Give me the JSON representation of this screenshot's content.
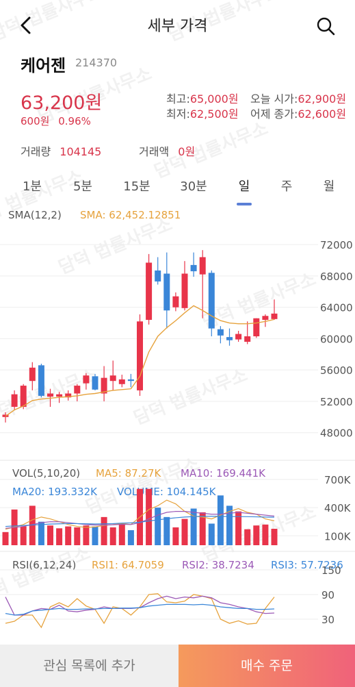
{
  "header": {
    "title": "세부 가격"
  },
  "stock": {
    "name": "케어젠",
    "code": "214370",
    "price": "63,200원",
    "change": "600원",
    "change_rate": "0.96%"
  },
  "stats": {
    "high_label": "최고:",
    "high": "65,000원",
    "open_label": "오늘 시가:",
    "open": "62,900원",
    "low_label": "최저:",
    "low": "62,500원",
    "prev_label": "어제 종가:",
    "prev": "62,600원",
    "volume_label": "거래량",
    "volume": "104145",
    "amount_label": "거래액",
    "amount": "0원"
  },
  "tabs": [
    "1분",
    "5분",
    "15분",
    "30분",
    "일",
    "주",
    "월"
  ],
  "active_tab": "일",
  "indicators": {
    "sma_label": "SMA(12,2)",
    "sma_value": "SMA: 62,452.12851",
    "vol_label": "VOL(5,10,20)",
    "ma5": "MA5: 87.27K",
    "ma10": "MA10: 169.441K",
    "ma20": "MA20: 193.332K",
    "volume": "VOLUME: 104.145K",
    "rsi_label": "RSI(6,12,24)",
    "rsi1": "RSI1: 64.7059",
    "rsi2": "RSI2: 38.7234",
    "rsi3": "RSI3: 57.7236"
  },
  "colors": {
    "up": "#e8344a",
    "down": "#3a86d8",
    "sma": "#e6a23c",
    "ma10": "#9b59b6",
    "ma20": "#3a86d8",
    "accent": "#d8344a"
  },
  "watermark": "담덕 법률사무소",
  "footer": {
    "watchlist": "관심 목록에 추가",
    "buy": "매수 주문"
  },
  "chart_data": {
    "type": "candlestick",
    "price_axis": {
      "ylim": [
        46400,
        72800
      ],
      "ticks": [
        "72000",
        "68000",
        "64000",
        "60000",
        "56000",
        "52000",
        "48000"
      ]
    },
    "volume_axis": {
      "ticks": [
        "700K",
        "400K",
        "100K"
      ]
    },
    "rsi_axis": {
      "ticks": [
        "150",
        "90",
        "30"
      ]
    },
    "candles": [
      {
        "o": 50000,
        "h": 50600,
        "l": 49300,
        "c": 50300
      },
      {
        "o": 51300,
        "h": 53400,
        "l": 50900,
        "c": 52900
      },
      {
        "o": 51300,
        "h": 54200,
        "l": 51000,
        "c": 54000
      },
      {
        "o": 54600,
        "h": 57000,
        "l": 53400,
        "c": 56300
      },
      {
        "o": 56600,
        "h": 56800,
        "l": 52500,
        "c": 52700
      },
      {
        "o": 52600,
        "h": 53600,
        "l": 51300,
        "c": 53000
      },
      {
        "o": 52600,
        "h": 53200,
        "l": 51800,
        "c": 52900
      },
      {
        "o": 52500,
        "h": 53400,
        "l": 52100,
        "c": 53000
      },
      {
        "o": 53000,
        "h": 54200,
        "l": 52000,
        "c": 54000
      },
      {
        "o": 54300,
        "h": 55600,
        "l": 53500,
        "c": 55300
      },
      {
        "o": 55200,
        "h": 55500,
        "l": 53400,
        "c": 53500
      },
      {
        "o": 53000,
        "h": 56500,
        "l": 52000,
        "c": 55000
      },
      {
        "o": 54600,
        "h": 57200,
        "l": 53400,
        "c": 55300
      },
      {
        "o": 54200,
        "h": 55400,
        "l": 53800,
        "c": 54800
      },
      {
        "o": 54800,
        "h": 55500,
        "l": 53800,
        "c": 54600
      },
      {
        "o": 53400,
        "h": 63100,
        "l": 52700,
        "c": 62200
      },
      {
        "o": 62400,
        "h": 70800,
        "l": 61800,
        "c": 69700
      },
      {
        "o": 68700,
        "h": 70400,
        "l": 66900,
        "c": 67300
      },
      {
        "o": 68300,
        "h": 71000,
        "l": 61300,
        "c": 63600
      },
      {
        "o": 64000,
        "h": 65900,
        "l": 63500,
        "c": 65400
      },
      {
        "o": 63900,
        "h": 69900,
        "l": 63600,
        "c": 68300
      },
      {
        "o": 69400,
        "h": 71000,
        "l": 67900,
        "c": 68600
      },
      {
        "o": 68200,
        "h": 71300,
        "l": 62600,
        "c": 70400
      },
      {
        "o": 68400,
        "h": 68700,
        "l": 60300,
        "c": 61300
      },
      {
        "o": 61200,
        "h": 61600,
        "l": 59400,
        "c": 60400
      },
      {
        "o": 60200,
        "h": 61300,
        "l": 59100,
        "c": 59800
      },
      {
        "o": 59900,
        "h": 61000,
        "l": 59600,
        "c": 60600
      },
      {
        "o": 59600,
        "h": 62200,
        "l": 59300,
        "c": 60300
      },
      {
        "o": 60300,
        "h": 62600,
        "l": 60100,
        "c": 62600
      },
      {
        "o": 62400,
        "h": 63100,
        "l": 61500,
        "c": 62900
      },
      {
        "o": 62500,
        "h": 65000,
        "l": 62400,
        "c": 63200
      }
    ],
    "sma": [
      50100,
      50900,
      51400,
      52100,
      52300,
      52400,
      52500,
      52600,
      52700,
      52900,
      53000,
      53200,
      53400,
      53500,
      53600,
      55200,
      58300,
      60300,
      61400,
      62300,
      63300,
      64200,
      63600,
      62900,
      62300,
      62000,
      61900,
      61900,
      62000,
      62200,
      62452
    ],
    "volume": [
      140,
      380,
      200,
      420,
      250,
      210,
      180,
      200,
      190,
      210,
      200,
      300,
      190,
      220,
      160,
      600,
      600,
      400,
      300,
      190,
      280,
      390,
      350,
      230,
      530,
      420,
      360,
      170,
      210,
      220,
      175
    ],
    "vol_ma5": [
      170,
      195,
      220,
      270,
      300,
      280,
      250,
      220,
      200,
      190,
      195,
      210,
      220,
      230,
      220,
      300,
      380,
      420,
      480,
      440,
      360,
      310,
      300,
      280,
      320,
      360,
      390,
      350,
      330,
      280,
      260
    ],
    "vol_ma10": [
      180,
      190,
      200,
      220,
      240,
      250,
      250,
      240,
      230,
      220,
      215,
      215,
      218,
      222,
      220,
      240,
      280,
      320,
      350,
      360,
      360,
      350,
      340,
      330,
      330,
      340,
      350,
      340,
      330,
      320,
      310
    ],
    "vol_ma20": [
      200,
      205,
      210,
      215,
      220,
      225,
      228,
      230,
      230,
      228,
      226,
      228,
      230,
      235,
      238,
      245,
      258,
      270,
      282,
      292,
      300,
      305,
      308,
      308,
      306,
      305,
      305,
      304,
      302,
      300,
      298
    ],
    "rsi1": [
      20,
      25,
      40,
      40,
      10,
      60,
      70,
      60,
      80,
      62,
      54,
      20,
      60,
      56,
      40,
      60,
      90,
      92,
      72,
      70,
      74,
      90,
      86,
      80,
      30,
      20,
      26,
      18,
      20,
      56,
      84
    ],
    "rsi2": [
      84,
      40,
      40,
      50,
      56,
      54,
      64,
      50,
      48,
      52,
      54,
      60,
      56,
      56,
      56,
      58,
      70,
      80,
      86,
      80,
      84,
      82,
      86,
      82,
      70,
      66,
      60,
      56,
      48,
      44,
      45
    ],
    "rsi3": [
      44,
      40,
      42,
      50,
      52,
      54,
      56,
      54,
      54,
      55,
      55,
      56,
      56,
      57,
      57,
      58,
      62,
      64,
      66,
      66,
      66,
      65,
      66,
      64,
      60,
      58,
      56,
      56,
      54,
      54,
      55
    ]
  }
}
